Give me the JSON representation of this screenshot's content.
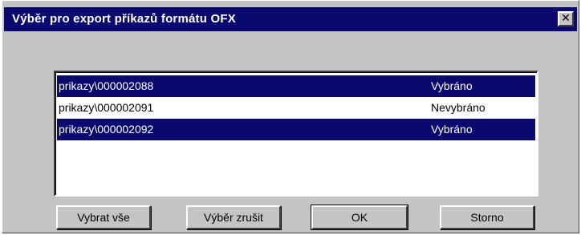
{
  "window": {
    "title": "Výběr pro export příkazů formátu OFX",
    "close_glyph": "✕",
    "close_icon": "close-icon"
  },
  "list": {
    "items": [
      {
        "path": "prikazy\\000002088",
        "status": "Vybráno",
        "selected": true
      },
      {
        "path": "prikazy\\000002091",
        "status": "Nevybráno",
        "selected": false
      },
      {
        "path": "prikazy\\000002092",
        "status": "Vybráno",
        "selected": true
      }
    ]
  },
  "buttons": {
    "select_all": "Vybrat vše",
    "cancel_selection": "Výběr zrušit",
    "ok": "OK",
    "storno": "Storno"
  },
  "colors": {
    "titlebar": "#0a0a6e",
    "selection": "#0a0a6e",
    "face": "#c6c3c6"
  }
}
